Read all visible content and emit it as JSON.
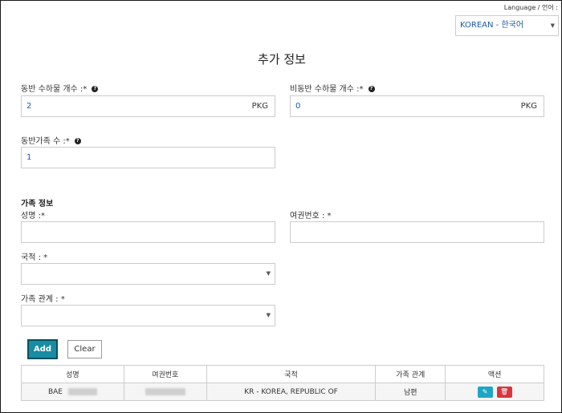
{
  "language": {
    "label": "Language / 언어 :",
    "selected": "KOREAN - 한국어"
  },
  "title": "추가 정보",
  "luggage": {
    "accompanied": {
      "label": "동반 수하물 개수 :*",
      "value": "2",
      "unit": "PKG"
    },
    "unaccompanied": {
      "label": "비동반 수하물 개수 :*",
      "value": "0",
      "unit": "PKG"
    }
  },
  "family_count": {
    "label": "동반가족 수 :*",
    "value": "1"
  },
  "family_info": {
    "section_title": "가족 정보",
    "name_label": "성명 :*",
    "passport_label": "여권번호 : *",
    "nationality_label": "국적 : *",
    "relationship_label": "가족 관계 : *"
  },
  "buttons": {
    "add": "Add",
    "clear": "Clear"
  },
  "table": {
    "headers": [
      "성명",
      "여권번호",
      "국적",
      "가족 관계",
      "액션"
    ],
    "rows": [
      {
        "name": "BAE",
        "nationality": "KR - KOREA, REPUBLIC OF",
        "relationship": "남편"
      }
    ]
  },
  "colors": {
    "accent": "#178ca3",
    "edit": "#1fa6c7",
    "delete": "#d9363e",
    "value_text": "#1e5aa8"
  },
  "icons": {
    "help": "question-circle-icon",
    "edit": "edit-icon",
    "delete": "trash-icon",
    "caret": "caret-down-icon"
  }
}
